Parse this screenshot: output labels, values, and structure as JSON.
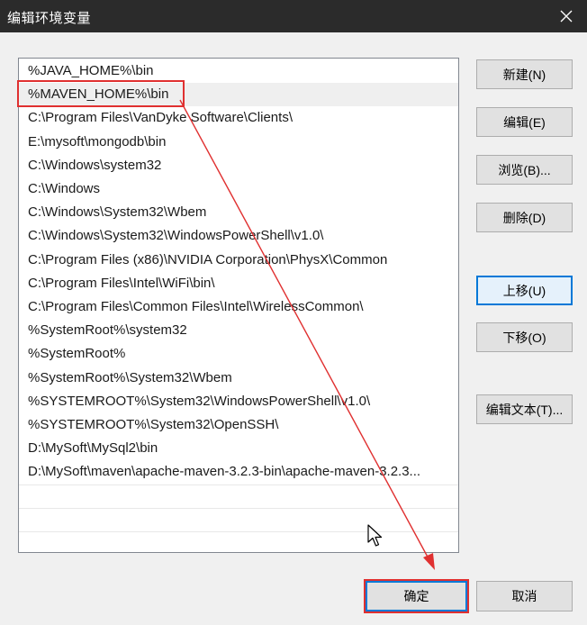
{
  "window": {
    "title": "编辑环境变量"
  },
  "list": {
    "items": [
      "%JAVA_HOME%\\bin",
      "%MAVEN_HOME%\\bin",
      "C:\\Program Files\\VanDyke Software\\Clients\\",
      "E:\\mysoft\\mongodb\\bin",
      "C:\\Windows\\system32",
      "C:\\Windows",
      "C:\\Windows\\System32\\Wbem",
      "C:\\Windows\\System32\\WindowsPowerShell\\v1.0\\",
      "C:\\Program Files (x86)\\NVIDIA Corporation\\PhysX\\Common",
      "C:\\Program Files\\Intel\\WiFi\\bin\\",
      "C:\\Program Files\\Common Files\\Intel\\WirelessCommon\\",
      "%SystemRoot%\\system32",
      "%SystemRoot%",
      "%SystemRoot%\\System32\\Wbem",
      "%SYSTEMROOT%\\System32\\WindowsPowerShell\\v1.0\\",
      "%SYSTEMROOT%\\System32\\OpenSSH\\",
      "D:\\MySoft\\MySql2\\bin",
      "D:\\MySoft\\maven\\apache-maven-3.2.3-bin\\apache-maven-3.2.3..."
    ],
    "selected_index": 1
  },
  "buttons": {
    "new": "新建(N)",
    "edit": "编辑(E)",
    "browse": "浏览(B)...",
    "delete": "删除(D)",
    "move_up": "上移(U)",
    "move_down": "下移(O)",
    "edit_text": "编辑文本(T)...",
    "ok": "确定",
    "cancel": "取消"
  },
  "colors": {
    "titlebar": "#2b2b2b",
    "annotation": "#e03030",
    "focus": "#0078d7"
  },
  "icons": {
    "close": "close-icon",
    "cursor": "mouse-pointer-icon"
  }
}
